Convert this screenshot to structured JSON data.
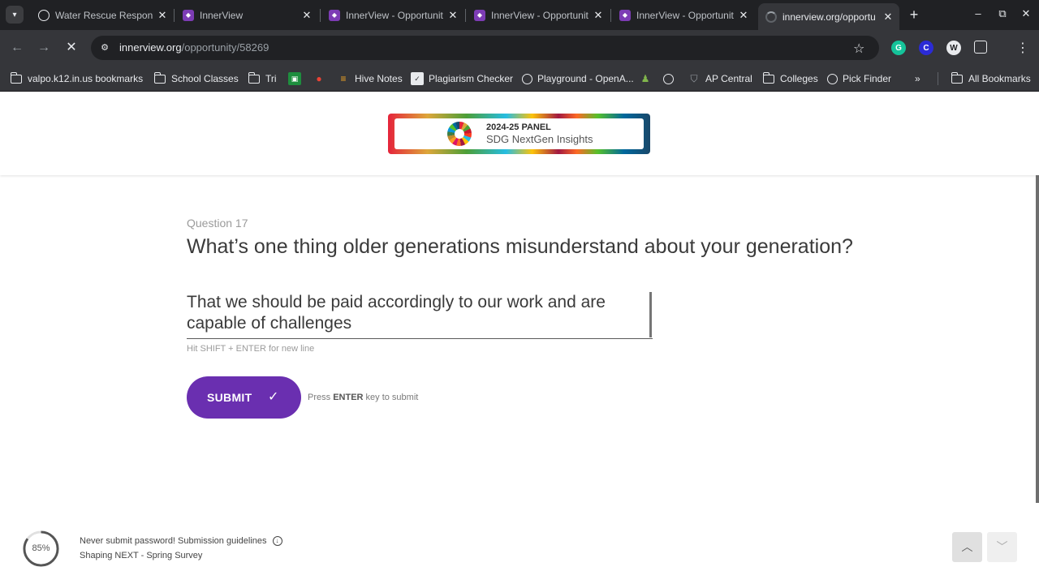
{
  "browser": {
    "tabs": [
      {
        "title": "Water Rescue Respons",
        "favicon": "openai-icon"
      },
      {
        "title": "InnerView",
        "favicon": "innerview-icon"
      },
      {
        "title": "InnerView - Opportunit",
        "favicon": "innerview-icon"
      },
      {
        "title": "InnerView - Opportunit",
        "favicon": "innerview-icon"
      },
      {
        "title": "InnerView - Opportunit",
        "favicon": "innerview-icon"
      },
      {
        "title": "innerview.org/opportu",
        "favicon": "loading-icon",
        "active": true
      }
    ],
    "url_host": "innerview.org",
    "url_path": "/opportunity/58269",
    "bookmarks": [
      "valpo.k12.in.us bookmarks",
      "School Classes",
      "Tri",
      "",
      "",
      "Hive Notes",
      "Plagiarism Checker",
      "Playground - OpenA...",
      "",
      "",
      "AP Central",
      "Colleges",
      "Pick Finder",
      "All Bookmarks"
    ]
  },
  "banner": {
    "line1_year": "2024-25",
    "line1_word": "PANEL",
    "line2": "SDG NextGen Insights"
  },
  "question": {
    "number_label": "Question 17",
    "title": "What’s one thing older generations misunderstand about your generation?",
    "answer": "That we should be paid accordingly to our work and are capable of challenges",
    "hint": "Hit SHIFT + ENTER for new line"
  },
  "submit": {
    "label": "SUBMIT",
    "hint_prefix": "Press",
    "hint_key": "ENTER",
    "hint_suffix": "key to submit"
  },
  "footer": {
    "progress": 85,
    "progress_label": "85%",
    "guidelines": "Never submit password! Submission guidelines",
    "survey_name": "Shaping NEXT - Spring Survey"
  },
  "colors": {
    "submit": "#6a2fb0",
    "chrome_dark": "#202124",
    "chrome": "#35363a"
  }
}
